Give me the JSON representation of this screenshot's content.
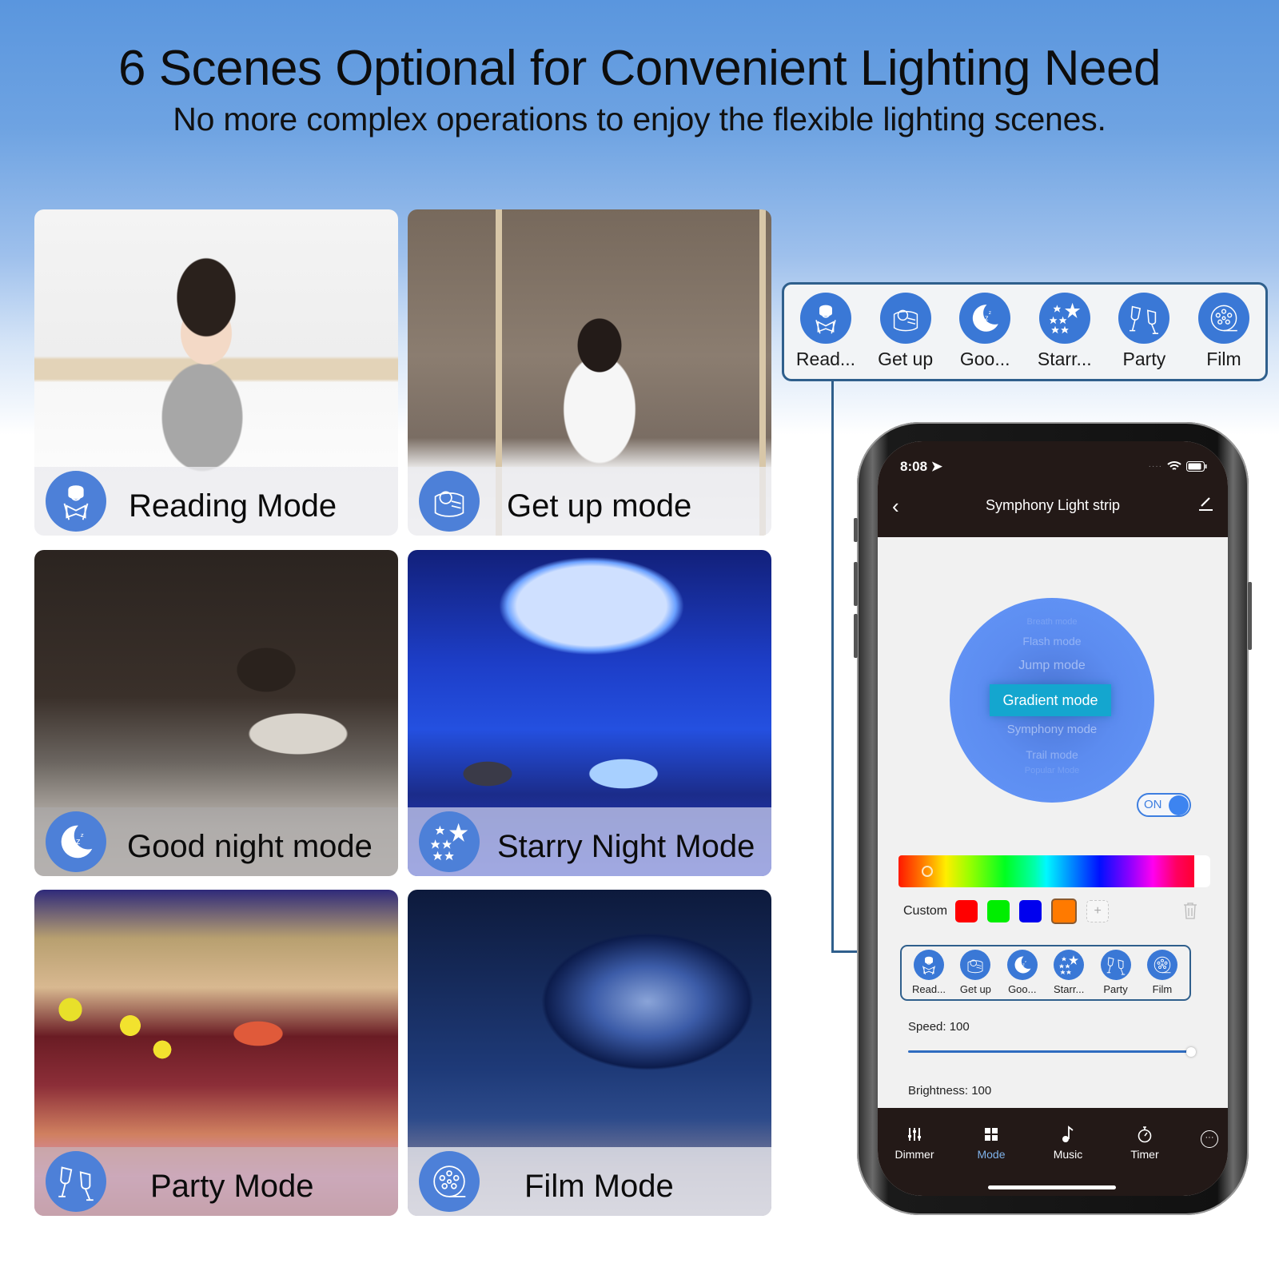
{
  "header": {
    "title": "6 Scenes Optional for Convenient Lighting Need",
    "subtitle": "No more complex operations to enjoy the flexible lighting scenes."
  },
  "scene_cards": [
    {
      "label": "Reading Mode",
      "icon": "reading-person-icon"
    },
    {
      "label": "Get up mode",
      "icon": "pillow-wake-icon"
    },
    {
      "label": "Good night mode",
      "icon": "moon-sleep-icon"
    },
    {
      "label": "Starry Night Mode",
      "icon": "stars-icon"
    },
    {
      "label": "Party Mode",
      "icon": "wine-glasses-icon"
    },
    {
      "label": "Film Mode",
      "icon": "film-reel-icon"
    }
  ],
  "scene_strip": {
    "items": [
      {
        "label": "Read...",
        "icon": "reading-person-icon"
      },
      {
        "label": "Get up",
        "icon": "pillow-wake-icon"
      },
      {
        "label": "Goo...",
        "icon": "moon-sleep-icon"
      },
      {
        "label": "Starr...",
        "icon": "stars-icon"
      },
      {
        "label": "Party",
        "icon": "wine-glasses-icon"
      },
      {
        "label": "Film",
        "icon": "film-reel-icon"
      }
    ]
  },
  "phone": {
    "status": {
      "time": "8:08"
    },
    "nav": {
      "title": "Symphony Light strip",
      "back_icon": "chevron-left-icon",
      "edit_icon": "pencil-icon"
    },
    "mode_wheel": {
      "options": [
        "Breath mode",
        "Flash mode",
        "Jump mode",
        "Gradient mode",
        "Symphony mode",
        "Trail mode",
        "Popular Mode"
      ],
      "selected": "Gradient mode"
    },
    "power_toggle": {
      "label": "ON",
      "state": true
    },
    "color_picker": {
      "hue_position": 0.04
    },
    "custom": {
      "label": "Custom",
      "swatches": [
        "#ff0000",
        "#00ee00",
        "#0000ee",
        "#ff7a00"
      ],
      "selected_index": 3,
      "add_label": "+"
    },
    "scenes": [
      {
        "label": "Read..."
      },
      {
        "label": "Get up"
      },
      {
        "label": "Goo..."
      },
      {
        "label": "Starr..."
      },
      {
        "label": "Party"
      },
      {
        "label": "Film"
      }
    ],
    "speed": {
      "label": "Speed: 100",
      "value": 100,
      "max": 100
    },
    "brightness": {
      "label": "Brightness: 100",
      "value": 100,
      "max": 100
    },
    "tabs": [
      {
        "label": "Dimmer",
        "icon": "sliders-icon",
        "active": false
      },
      {
        "label": "Mode",
        "icon": "grid-icon",
        "active": true
      },
      {
        "label": "Music",
        "icon": "music-note-icon",
        "active": false
      },
      {
        "label": "Timer",
        "icon": "stopwatch-icon",
        "active": false
      }
    ],
    "more_label": "···"
  },
  "colors": {
    "accent_blue": "#3a78d6",
    "strip_border": "#2f5f8c",
    "app_bar": "#231917",
    "selected_mode": "#14a6cf"
  }
}
